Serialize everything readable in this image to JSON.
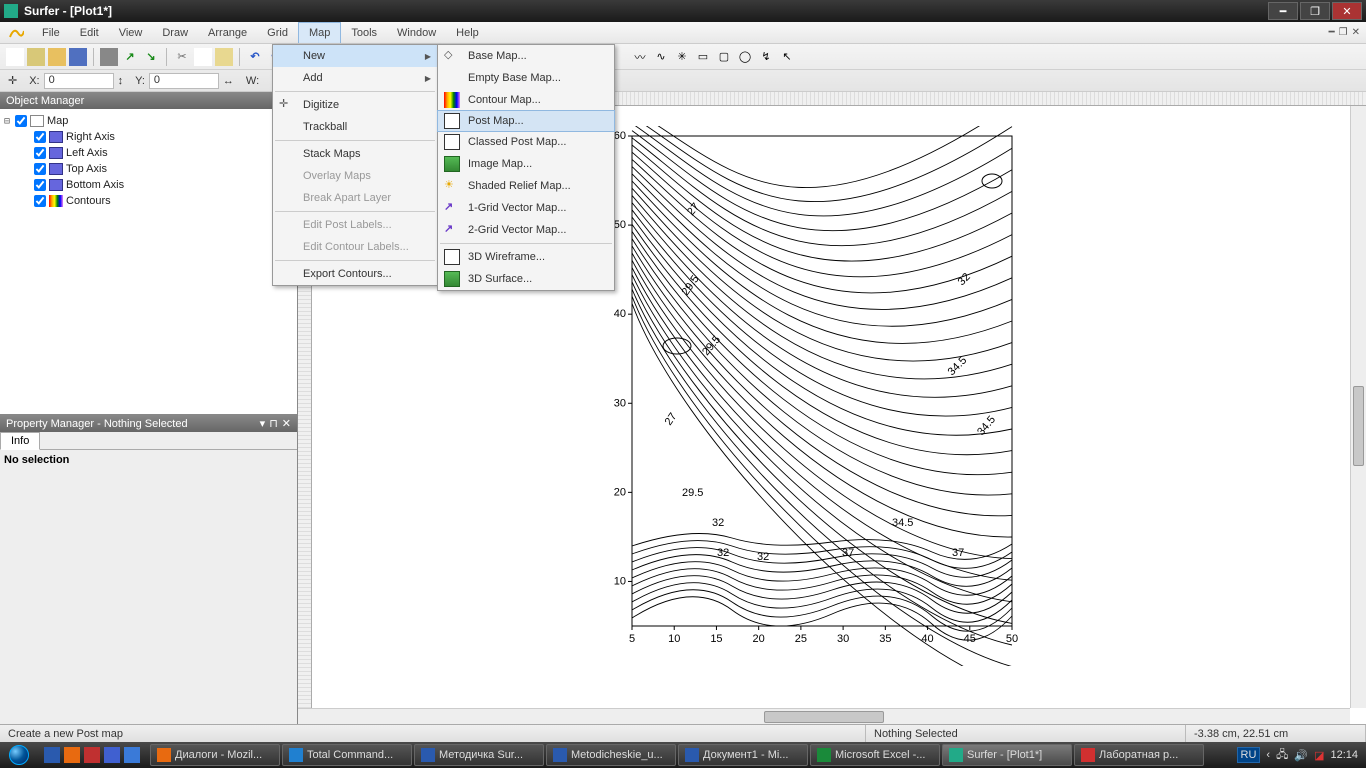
{
  "window": {
    "title": "Surfer - [Plot1*]"
  },
  "menu": {
    "items": [
      "File",
      "Edit",
      "View",
      "Draw",
      "Arrange",
      "Grid",
      "Map",
      "Tools",
      "Window",
      "Help"
    ],
    "open_idx": 6
  },
  "map_menu": {
    "items": [
      {
        "label": "New",
        "expand": true,
        "hl": true
      },
      {
        "label": "Add",
        "expand": true
      },
      "sep",
      {
        "label": "Digitize",
        "icon": "cross"
      },
      {
        "label": "Trackball"
      },
      "sep",
      {
        "label": "Stack Maps"
      },
      {
        "label": "Overlay Maps",
        "disabled": true
      },
      {
        "label": "Break Apart Layer",
        "disabled": true
      },
      "sep",
      {
        "label": "Edit Post Labels...",
        "disabled": true
      },
      {
        "label": "Edit Contour Labels...",
        "disabled": true
      },
      "sep",
      {
        "label": "Export Contours..."
      }
    ]
  },
  "new_menu": {
    "items": [
      {
        "label": "Base Map...",
        "icon": "base"
      },
      {
        "label": "Empty Base Map..."
      },
      {
        "label": "Contour Map...",
        "icon": "rainbow"
      },
      {
        "label": "Post Map...",
        "icon": "dots",
        "hover": true
      },
      {
        "label": "Classed Post Map...",
        "icon": "dots"
      },
      {
        "label": "Image Map...",
        "icon": "img"
      },
      {
        "label": "Shaded Relief Map...",
        "icon": "sun"
      },
      {
        "label": "1-Grid Vector Map...",
        "icon": "vec"
      },
      {
        "label": "2-Grid Vector Map...",
        "icon": "vec"
      },
      "sep",
      {
        "label": "3D Wireframe...",
        "icon": "wire"
      },
      {
        "label": "3D Surface...",
        "icon": "img"
      }
    ]
  },
  "coords": {
    "x_label": "X:",
    "x": "0",
    "y_label": "Y:",
    "y": "0",
    "w_label": "W:"
  },
  "object_manager": {
    "title": "Object Manager",
    "root": "Map",
    "children": [
      "Right Axis",
      "Left Axis",
      "Top Axis",
      "Bottom Axis",
      "Contours"
    ]
  },
  "property_manager": {
    "title": "Property Manager - Nothing Selected",
    "tab": "Info",
    "body": "No selection"
  },
  "status": {
    "hint": "Create a new Post map",
    "selection": "Nothing Selected",
    "coords": "-3.38 cm, 22.51 cm"
  },
  "chart_data": {
    "type": "contour",
    "xlim": [
      5,
      50
    ],
    "xtick": [
      5,
      10,
      15,
      20,
      25,
      30,
      35,
      40,
      45,
      50
    ],
    "ylim": [
      5,
      60
    ],
    "ytick": [
      10,
      20,
      30,
      40,
      50,
      60
    ],
    "contour_labels": [
      "27",
      "27",
      "29.5",
      "29.5",
      "29.5",
      "32",
      "32",
      "32",
      "32",
      "34.5",
      "34.5",
      "34.5",
      "37",
      "37"
    ]
  },
  "taskbar": {
    "tasks": [
      {
        "label": "Диалоги - Mozil...",
        "icon": "#e86a10"
      },
      {
        "label": "Total Command...",
        "icon": "#2080d0"
      },
      {
        "label": "Методичка Sur...",
        "icon": "#2a5aae"
      },
      {
        "label": "Metodicheskie_u...",
        "icon": "#2a5aae"
      },
      {
        "label": "Документ1 - Mi...",
        "icon": "#2a5aae"
      },
      {
        "label": "Microsoft Excel -...",
        "icon": "#1a8a3a"
      },
      {
        "label": "Surfer - [Plot1*]",
        "icon": "#22aa88",
        "active": true
      },
      {
        "label": "Лаборатная р...",
        "icon": "#d03030"
      }
    ],
    "lang": "RU",
    "clock": "12:14"
  }
}
